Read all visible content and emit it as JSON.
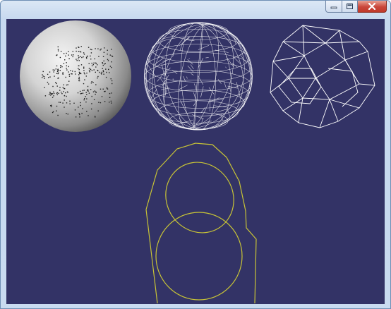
{
  "window": {
    "title": "",
    "controls": {
      "minimize_icon": "minimize-icon",
      "maximize_icon": "maximize-icon",
      "close_icon": "close-icon"
    }
  },
  "viewport": {
    "background": "#333366",
    "objects": [
      {
        "name": "shaded-sphere",
        "style": "shaded",
        "color": "#d6d6d6"
      },
      {
        "name": "dense-wireframe-sphere",
        "style": "wireframe",
        "color": "#ffffff"
      },
      {
        "name": "coarse-wireframe-polyhedron",
        "style": "wireframe",
        "color": "#ffffff"
      },
      {
        "name": "yellow-curves",
        "style": "curves",
        "color": "#c8c436"
      }
    ]
  }
}
